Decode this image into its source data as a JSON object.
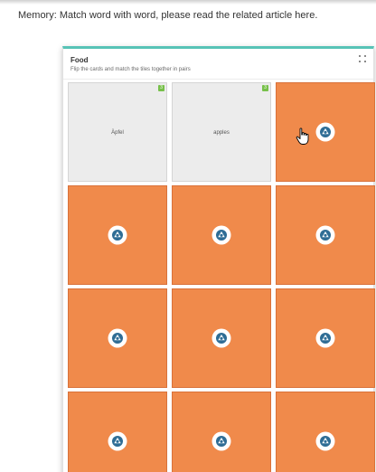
{
  "instruction": "Memory: Match word with word, please read the related article here.",
  "widget": {
    "title": "Food",
    "subtitle": "Flip the cards and match the tiles together in pairs"
  },
  "colors": {
    "card_back": "#f08a4b",
    "card_face": "#ececec",
    "accent": "#57c3b6",
    "match_badge": "#77c04a"
  },
  "cards": [
    {
      "state": "face",
      "text": "Äpfel",
      "badge": "3"
    },
    {
      "state": "face",
      "text": "apples",
      "badge": "3"
    },
    {
      "state": "back",
      "icon": "memory-logo-icon"
    },
    {
      "state": "back",
      "icon": "memory-logo-icon"
    },
    {
      "state": "back",
      "icon": "memory-logo-icon"
    },
    {
      "state": "back",
      "icon": "memory-logo-icon"
    },
    {
      "state": "back",
      "icon": "memory-logo-icon"
    },
    {
      "state": "back",
      "icon": "memory-logo-icon"
    },
    {
      "state": "back",
      "icon": "memory-logo-icon"
    },
    {
      "state": "back",
      "icon": "memory-logo-icon"
    },
    {
      "state": "back",
      "icon": "memory-logo-icon"
    },
    {
      "state": "back",
      "icon": "memory-logo-icon"
    }
  ]
}
